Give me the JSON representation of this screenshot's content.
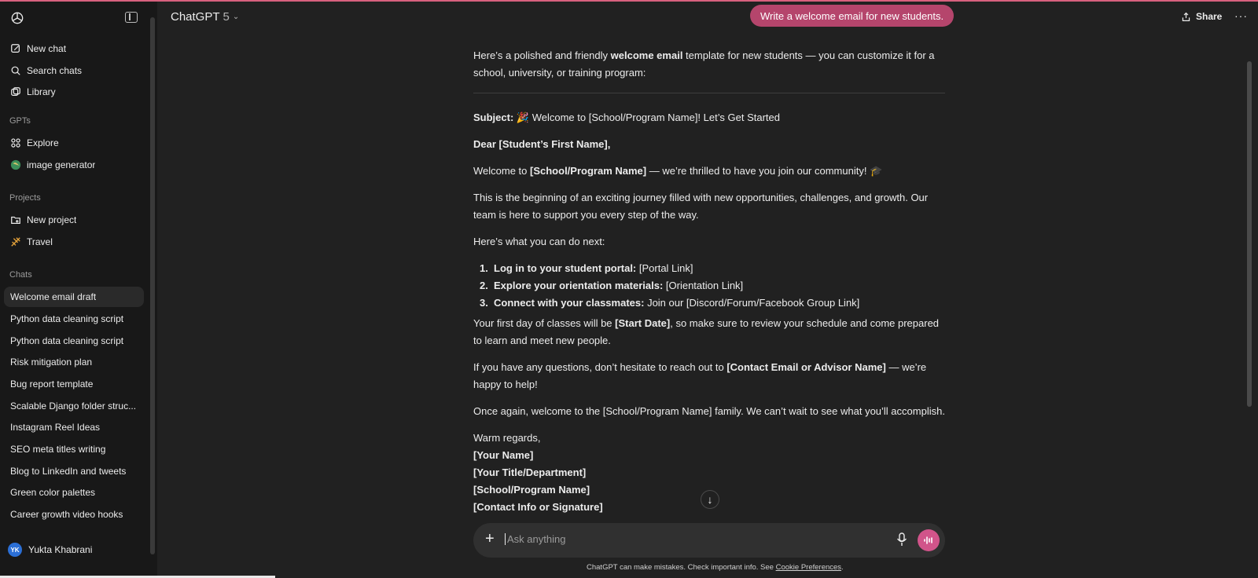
{
  "header": {
    "model_name": "ChatGPT",
    "model_version": "5",
    "share_label": "Share",
    "more_label": "···"
  },
  "sidebar": {
    "top_items": [
      {
        "label": "New chat",
        "icon": "edit-icon"
      },
      {
        "label": "Search chats",
        "icon": "search-icon"
      },
      {
        "label": "Library",
        "icon": "library-icon"
      }
    ],
    "gpts_heading": "GPTs",
    "gpts": [
      {
        "label": "Explore",
        "icon": "grid-icon"
      },
      {
        "label": "image generator",
        "icon": "globe-icon"
      }
    ],
    "projects_heading": "Projects",
    "projects": [
      {
        "label": "New project",
        "icon": "folder-plus-icon"
      },
      {
        "label": "Travel",
        "icon": "plane-icon"
      }
    ],
    "chats_heading": "Chats",
    "chats": [
      "Welcome email draft",
      "Python data cleaning script",
      "Python data cleaning script",
      "Risk mitigation plan",
      "Bug report template",
      "Scalable Django folder struc...",
      "Instagram Reel Ideas",
      "SEO meta titles writing",
      "Blog to LinkedIn and tweets",
      "Green color palettes",
      "Career growth video hooks"
    ],
    "user": {
      "initials": "YK",
      "name": "Yukta Khabrani"
    }
  },
  "user_message": "Write a welcome email for new students.",
  "assistant": {
    "intro_1": "Here’s a polished and friendly ",
    "intro_bold": "welcome email",
    "intro_2": " template for new students — you can customize it for a school, university, or training program:",
    "subject_label": "Subject:",
    "subject_text": " 🎉 Welcome to [School/Program Name]! Let’s Get Started",
    "greeting": "Dear [Student’s First Name],",
    "welcome_1": "Welcome to ",
    "welcome_bold": "[School/Program Name]",
    "welcome_2": " — we’re thrilled to have you join our community! 🎓",
    "journey": "This is the beginning of an exciting journey filled with new opportunities, challenges, and growth. Our team is here to support you every step of the way.",
    "next_intro": "Here’s what you can do next:",
    "steps": [
      {
        "num": "1.",
        "bold": "Log in to your student portal:",
        "text": " [Portal Link]"
      },
      {
        "num": "2.",
        "bold": "Explore your orientation materials:",
        "text": " [Orientation Link]"
      },
      {
        "num": "3.",
        "bold": "Connect with your classmates:",
        "text": " Join our [Discord/Forum/Facebook Group Link]"
      }
    ],
    "first_day_1": "Your first day of classes will be ",
    "first_day_bold": "[Start Date]",
    "first_day_2": ", so make sure to review your schedule and come prepared to learn and meet new people.",
    "questions_1": "If you have any questions, don’t hesitate to reach out to ",
    "questions_bold": "[Contact Email or Advisor Name]",
    "questions_2": " — we’re happy to help!",
    "closing": "Once again, welcome to the [School/Program Name] family. We can’t wait to see what you’ll accomplish.",
    "regards": "Warm regards,",
    "signature": [
      "[Your Name]",
      "[Your Title/Department]",
      "[School/Program Name]",
      "[Contact Info or Signature]"
    ]
  },
  "composer": {
    "placeholder": "Ask anything"
  },
  "footer": {
    "disclaimer": "ChatGPT can make mistakes. Check important info. See ",
    "cookie_link": "Cookie Preferences",
    "period": "."
  },
  "colors": {
    "accent_pink": "#d1548a",
    "bubble": "#b5456c",
    "background": "#212121",
    "sidebar": "#181818"
  }
}
